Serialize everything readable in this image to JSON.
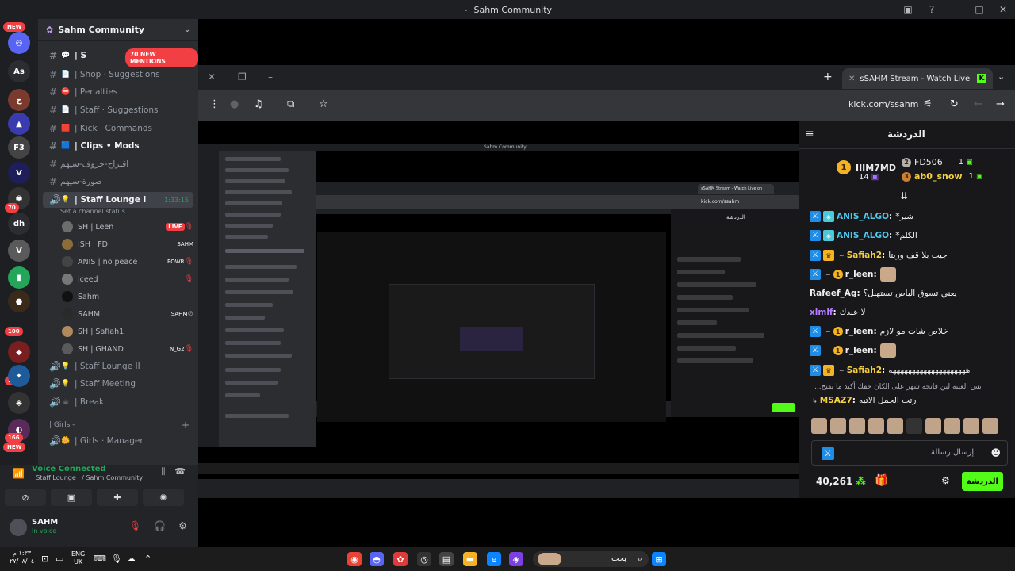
{
  "window": {
    "title": "Sahm Community"
  },
  "rail": {
    "new1": "NEW",
    "new2": "NEW",
    "servers": [
      "As",
      "dh",
      "F3"
    ],
    "badges": [
      "70",
      "176",
      "100",
      "166"
    ]
  },
  "sidebar": {
    "guild_name": "Sahm Community",
    "mentions": "70 NEW MENTIONS",
    "channels": [
      {
        "label": "| Shop · Suggestions"
      },
      {
        "label": "| Penalties"
      },
      {
        "label": "| Staff · Suggestions"
      },
      {
        "label": "| Kick · Commands"
      },
      {
        "label": "| Clips • Mods"
      },
      {
        "label": "اقتراح-حروف-سيهم"
      },
      {
        "label": "صورة-سيهم"
      }
    ],
    "first_channel_visible": "| S",
    "voice_channel": {
      "label": "| Staff Lounge I",
      "time": "1:33:15",
      "status": "Set a channel status"
    },
    "voice_users": [
      {
        "name": "SH | Leen",
        "tag": "",
        "live": "LIVE"
      },
      {
        "name": "ISH | FD",
        "tag": "SAHM",
        "live": ""
      },
      {
        "name": "ANIS | no peace",
        "tag": "POWR",
        "live": ""
      },
      {
        "name": "iceed",
        "tag": "",
        "live": ""
      },
      {
        "name": "Sahm",
        "tag": "",
        "live": ""
      },
      {
        "name": "SAHM",
        "tag": "SAHM",
        "live": ""
      },
      {
        "name": "SH | Safiah1",
        "tag": "",
        "live": ""
      },
      {
        "name": "SH | GHAND",
        "tag": "N_G2",
        "live": ""
      }
    ],
    "after_voice": [
      {
        "label": "| Staff Lounge II"
      },
      {
        "label": "| Staff Meeting"
      },
      {
        "label": "| Break"
      }
    ],
    "category": "| Girls -",
    "girls_channel": "| Girls · Manager"
  },
  "voice_panel": {
    "title": "Voice Connected",
    "subtitle": "| Staff Lounge I / Sahm Community"
  },
  "user_panel": {
    "name": "SAHM",
    "status": "In voice"
  },
  "browser": {
    "tab_title": "sSAHM Stream - Watch Live on",
    "url": "kick.com/ssahm"
  },
  "chat": {
    "title": "الدردشة",
    "gifters": [
      {
        "rank": "1",
        "name": "IIIM7MD",
        "count": "14"
      },
      {
        "name": "FD506",
        "count": "1"
      },
      {
        "name": "ab0_snow",
        "count": "1"
      }
    ],
    "messages": [
      {
        "user": "ANIS_ALGO",
        "sep": ":",
        "text": "*شير"
      },
      {
        "user": "ANIS_ALGO",
        "sep": ":",
        "text": "*الكلم"
      },
      {
        "user": "Safiah2",
        "sep": ":",
        "text": "جيت بلا قف وريتا"
      },
      {
        "user": "r_leen",
        "sep": ":",
        "text": ""
      },
      {
        "user": "Rafeef_Ag",
        "sep": ":",
        "text": "يعني تسوق الباص تستهبل؟"
      },
      {
        "user": "xlmlf",
        "sep": ":",
        "text": "لا عندك"
      },
      {
        "user": "r_leen",
        "sep": ":",
        "text": "خلاص شات مو لازم"
      },
      {
        "user": "r_leen",
        "sep": ":",
        "text": ""
      },
      {
        "user": "Safiah2",
        "sep": ":",
        "text": "ههههههههههههههههههههه"
      },
      {
        "user": "MSAZ7",
        "sep": ":",
        "text": "رتب الجمل الاتيه"
      }
    ],
    "reply_note": "...بس العيبه لين فاتحه شهر على الكان حقك أكيد ما يفتح",
    "input_placeholder": "إرسال رسالة",
    "points": "40,261",
    "send_label": "الدردشة"
  },
  "taskbar": {
    "clock_time": "١:٣٣ م",
    "clock_date": "٢٧/٠٨/٠٤",
    "lang_top": "ENG",
    "lang_bottom": "UK",
    "search_label": "بحث"
  }
}
